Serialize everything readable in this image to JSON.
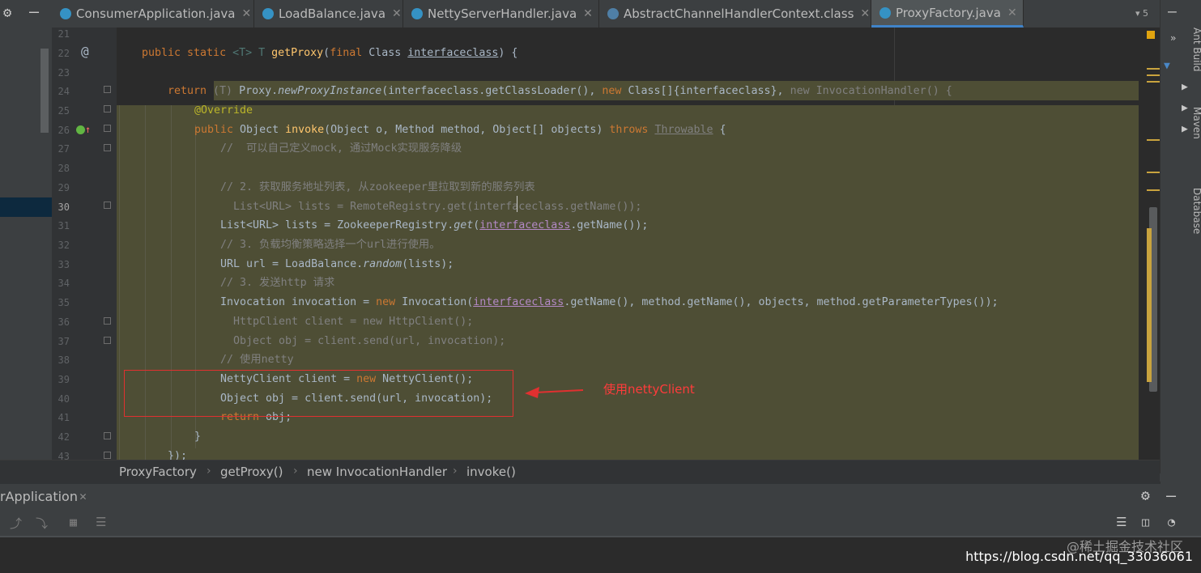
{
  "tabs": [
    {
      "label": "ConsumerApplication.java",
      "active": false
    },
    {
      "label": "LoadBalance.java",
      "active": false
    },
    {
      "label": "NettyServerHandler.java",
      "active": false
    },
    {
      "label": "AbstractChannelHandlerContext.class",
      "active": false
    },
    {
      "label": "ProxyFactory.java",
      "active": true
    }
  ],
  "tab_overflow_count": "5",
  "gutter": {
    "line_numbers": [
      "21",
      "22",
      "23",
      "24",
      "25",
      "26",
      "27",
      "28",
      "29",
      "30",
      "31",
      "32",
      "33",
      "34",
      "35",
      "36",
      "37",
      "38",
      "39",
      "40",
      "41",
      "42",
      "43"
    ],
    "current_line": "30",
    "at_marker": "@",
    "comment_marker": "//"
  },
  "code": {
    "l22_mod": "public static ",
    "l22_tp": "<T> T ",
    "l22_fn": "getProxy",
    "l22_rest": "(",
    "l22_final": "final ",
    "l22_cls": "Class ",
    "l22_param": "interfaceclass",
    "l22_end": ") {",
    "l24_ret": "return ",
    "l24_cast": "(T) ",
    "l24_proxy": "Proxy.",
    "l24_npi": "newProxyInstance",
    "l24_a": "(interfaceclass.getClassLoader(), ",
    "l24_new": "new ",
    "l24_b": "Class[]{interfaceclass}, ",
    "l24_c": "new InvocationHandler() {",
    "l25": "@Override",
    "l26_pub": "public ",
    "l26_a": "Object ",
    "l26_fn": "invoke",
    "l26_b": "(Object o, Method method, Object[] objects) ",
    "l26_throws": "throws ",
    "l26_thr": "Throwable",
    "l26_end": " {",
    "l27": "//  可以自己定义mock, 通过Mock实现服务降级",
    "l29": "// 2. 获取服务地址列表, 从zookeeper里拉取到新的服务列表",
    "l30": "  List<URL> lists = RemoteRegistry.get(interfaceclass.getName());",
    "l31_a": "List<URL> lists = ZookeeperRegistry.",
    "l31_get": "get",
    "l31_b": "(",
    "l31_p": "interfaceclass",
    "l31_c": ".getName());",
    "l32": "// 3. 负载均衡策略选择一个url进行使用。",
    "l33_a": "URL url = LoadBalance.",
    "l33_rnd": "random",
    "l33_b": "(lists);",
    "l34": "// 3. 发送http 请求",
    "l35_a": "Invocation invocation = ",
    "l35_new": "new ",
    "l35_b": "Invocation(",
    "l35_p": "interfaceclass",
    "l35_c": ".getName(), method.getName(), objects, method.getParameterTypes());",
    "l36": "  HttpClient client = new HttpClient();",
    "l37": "  Object obj = client.send(url, invocation);",
    "l38": "// 使用netty",
    "l39_a": "NettyClient client = ",
    "l39_new": "new ",
    "l39_b": "NettyClient();",
    "l40": "Object obj = client.send(url, invocation);",
    "l41_ret": "return ",
    "l41_b": "obj;",
    "l42": "}",
    "l43": "});"
  },
  "annotation": {
    "text": "使用nettyClient",
    "color": "#ff3b3b"
  },
  "right_tools": {
    "ant_build": "Ant Build",
    "maven": "Maven",
    "database": "Database"
  },
  "breadcrumb": [
    "ProxyFactory",
    "getProxy()",
    "new InvocationHandler",
    "invoke()"
  ],
  "run_panel": {
    "title": "rApplication"
  },
  "watermark": {
    "line1": "@稀土掘金技术社区",
    "line2": "https://blog.csdn.net/qq_33036061"
  },
  "colors": {
    "keyword": "#cc7832",
    "method": "#ffc66d",
    "annotation": "#bbb529",
    "comment": "#808080",
    "highlight": "#4e4e35",
    "text": "#a9b7c6"
  }
}
